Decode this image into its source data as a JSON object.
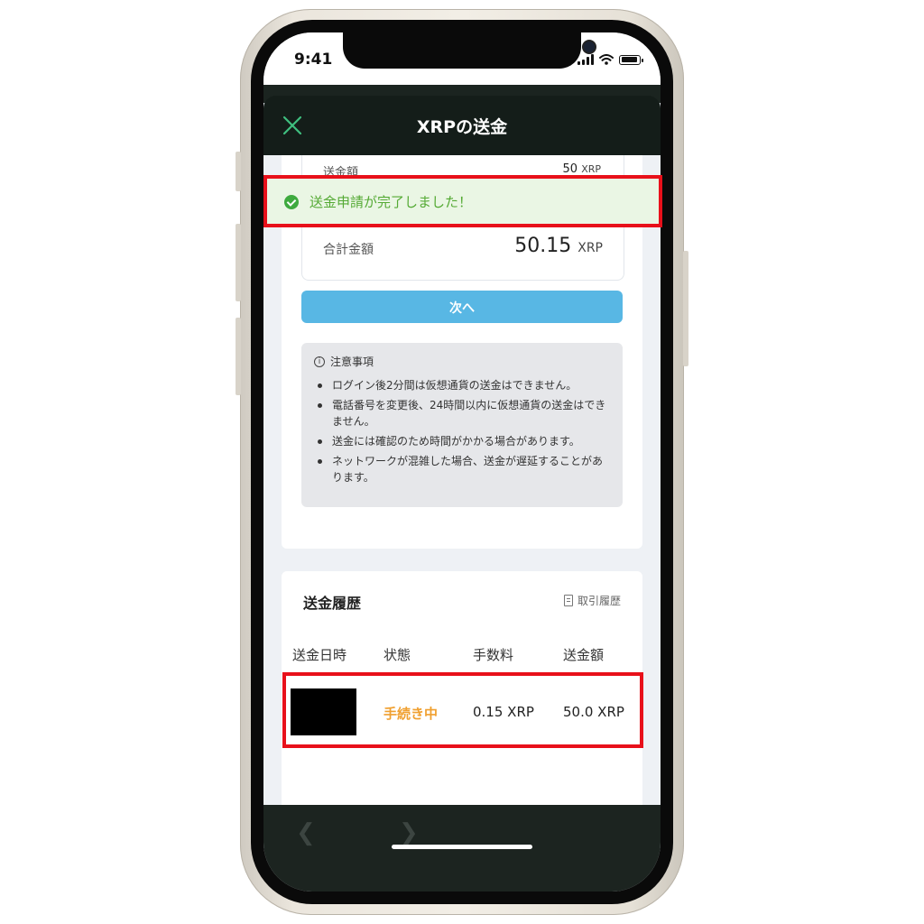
{
  "status_bar": {
    "time": "9:41"
  },
  "header": {
    "title": "XRPの送金",
    "close_icon": "close-icon"
  },
  "summary": {
    "amount_label": "送金額",
    "amount_value": "50",
    "amount_unit": "XRP",
    "total_label": "合計金額",
    "total_value": "50.15",
    "total_unit": "XRP"
  },
  "toast": {
    "message": "送金申請が完了しました！",
    "icon": "check-circle-icon",
    "color": "#3eaa3e"
  },
  "next_button": {
    "label": "次へ",
    "color": "#58b7e4"
  },
  "notice": {
    "title": "注意事項",
    "items": [
      "ログイン後2分間は仮想通貨の送金はできません。",
      "電話番号を変更後、24時間以内に仮想通貨の送金はできません。",
      "送金には確認のため時間がかかる場合があります。",
      "ネットワークが混雑した場合、送金が遅延することがあります。"
    ]
  },
  "history": {
    "title": "送金履歴",
    "link_label": "取引履歴",
    "columns": [
      "送金日時",
      "状態",
      "手数料",
      "送金額"
    ],
    "rows": [
      {
        "date": "",
        "status": "手続き中",
        "fee": "0.15 XRP",
        "amount": "50.0 XRP"
      }
    ]
  },
  "colors": {
    "highlight": "#e8101a",
    "status_pending": "#f0a030"
  }
}
